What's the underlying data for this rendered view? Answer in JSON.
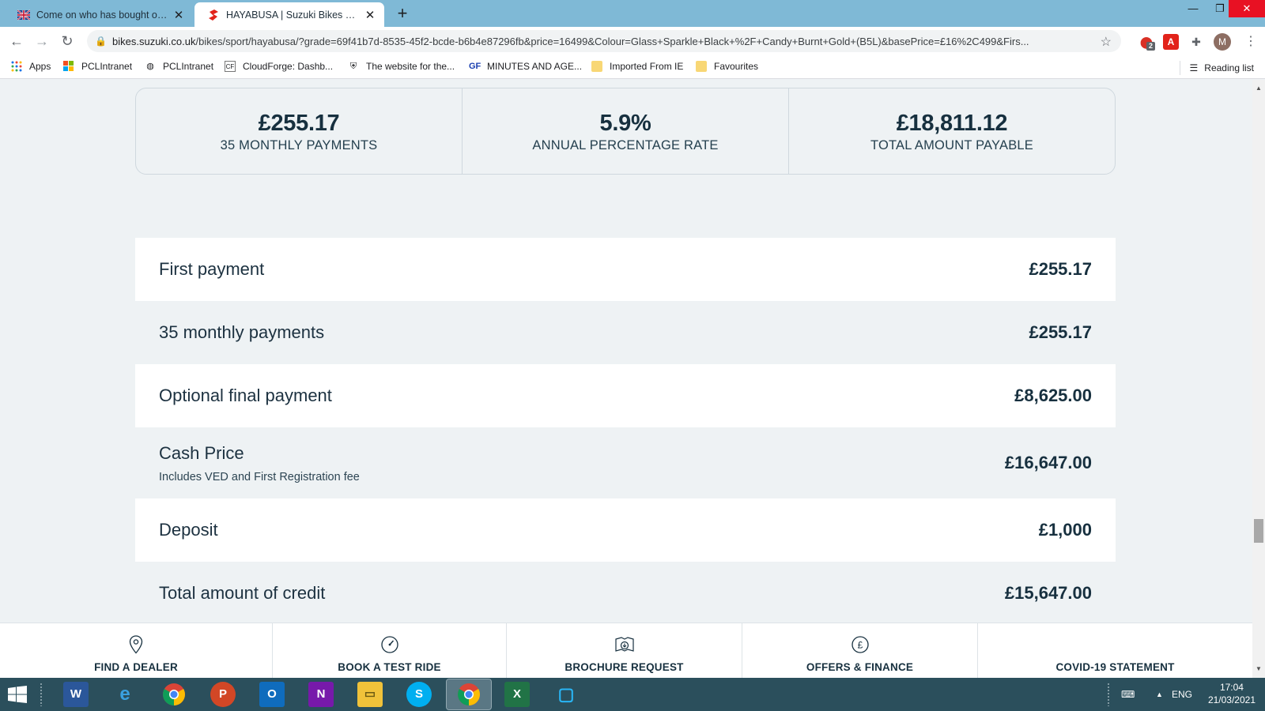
{
  "browser": {
    "tabs": [
      {
        "title": "Come on who has bought one ?? ...",
        "active": false
      },
      {
        "title": "HAYABUSA | Suzuki Bikes UK",
        "active": true
      }
    ],
    "url_host": "bikes.suzuki.co.uk",
    "url_path": "/bikes/sport/hayabusa/?grade=69f41b7d-8535-45f2-bcde-b6b4e87296fb&price=16499&Colour=Glass+Sparkle+Black+%2F+Candy+Burnt+Gold+(B5L)&basePrice=£16%2C499&Firs...",
    "extension_badge": "2",
    "profile_initial": "M",
    "bookmarks": [
      "Apps",
      "PCLIntranet",
      "PCLIntranet",
      "CloudForge: Dashb...",
      "The website for the...",
      "MINUTES AND AGE...",
      "Imported From IE",
      "Favourites"
    ],
    "reading_list": "Reading list"
  },
  "summary": [
    {
      "value": "£255.17",
      "label": "35 MONTHLY PAYMENTS"
    },
    {
      "value": "5.9%",
      "label": "ANNUAL PERCENTAGE RATE"
    },
    {
      "value": "£18,811.12",
      "label": "TOTAL AMOUNT PAYABLE"
    }
  ],
  "rows": [
    {
      "label": "First payment",
      "value": "£255.17"
    },
    {
      "label": "35 monthly payments",
      "value": "£255.17"
    },
    {
      "label": "Optional final payment",
      "value": "£8,625.00"
    },
    {
      "label": "Cash Price",
      "sub": "Includes VED and First Registration fee",
      "value": "£16,647.00"
    },
    {
      "label": "Deposit",
      "value": "£1,000"
    },
    {
      "label": "Total amount of credit",
      "value": "£15,647.00"
    }
  ],
  "footer_nav": [
    {
      "label": "FIND A DEALER",
      "icon": "map-pin-icon"
    },
    {
      "label": "BOOK A TEST RIDE",
      "icon": "speedometer-icon"
    },
    {
      "label": "BROCHURE REQUEST",
      "icon": "brochure-download-icon"
    },
    {
      "label": "OFFERS & FINANCE",
      "icon": "pound-coin-icon"
    },
    {
      "label": "COVID-19 STATEMENT",
      "icon": ""
    }
  ],
  "taskbar": {
    "language": "ENG",
    "time": "17:04",
    "date": "21/03/2021"
  },
  "colors": {
    "page_bg": "#eef2f4",
    "text_dark": "#17303f",
    "tab_strip": "#7fb9d6",
    "taskbar": "#2b4f5c"
  }
}
